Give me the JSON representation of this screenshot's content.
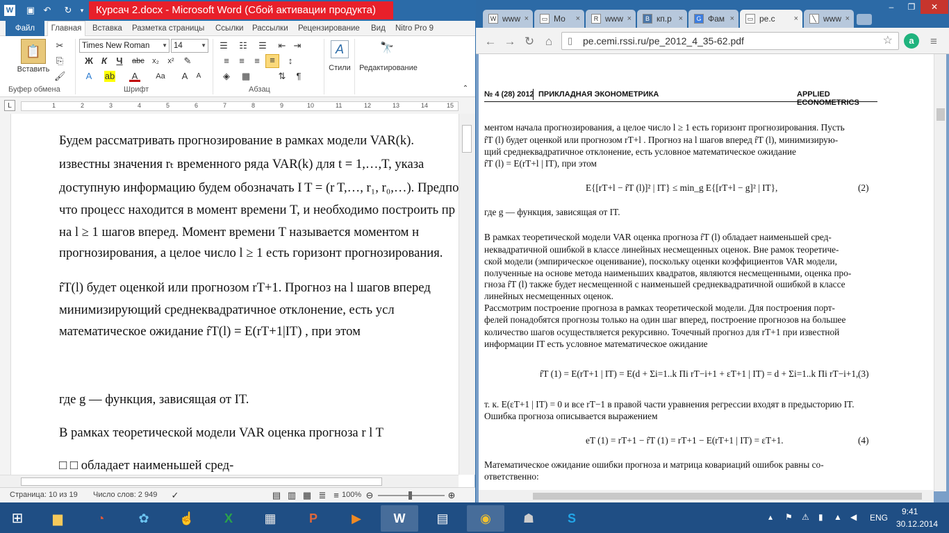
{
  "word": {
    "title": "Курсач 2.docx - Microsoft Word (Сбой активации продукта)",
    "tabs": [
      "Файл",
      "Главная",
      "Вставка",
      "Разметка страницы",
      "Ссылки",
      "Рассылки",
      "Рецензирование",
      "Вид",
      "Nitro Pro 9"
    ],
    "ribbon": {
      "paste_label": "Вставить",
      "font_name": "Times New Roman",
      "font_size": "14",
      "styles_label": "Стили",
      "editing_label": "Редактирование",
      "group_clipboard": "Буфер обмена",
      "group_font": "Шрифт",
      "group_paragraph": "Абзац"
    },
    "ruler_marks": [
      "1",
      "2",
      "3",
      "4",
      "5",
      "6",
      "7",
      "8",
      "9",
      "10",
      "11",
      "12",
      "13",
      "14",
      "15"
    ],
    "doc_lines": [
      "Будем  рассматривать  прогнозирование  в рамках  модели  VAR(k).",
      "известны значения rₜ временного ряда VAR(k) для t = 1,…,T, указа",
      "доступную информацию будем обозначать I T = (r T,…, r₁, r₀,…). Предпол",
      "что процесс находится в момент времени T, и необходимо построить пр",
      "на  l ≥ 1  шагов  вперед.  Момент  времени  T  называется  моментом  н",
      "прогнозирования, а целое число l ≥ 1 есть горизонт прогнозирования.",
      "r̂T(l)   будет  оценкой  или прогнозом  rT+1.  Прогноз  на  l шагов  вперед",
      "минимизирующий       среднеквадратичное       отклонение,       есть       усл",
      "математическое ожидание r̂T(l) = E(rT+1|IT) , при этом",
      "где g — функция, зависящая от IT.",
      "В рамках теоретической модели VAR оценка прогноза r l T",
      "  □  □  обладает наименьшей сред-"
    ],
    "status": {
      "page": "Страница: 10 из 19",
      "words": "Число слов: 2 949",
      "zoom": "100%"
    }
  },
  "chrome": {
    "tabs": [
      {
        "fav": "W",
        "label": "www"
      },
      {
        "fav": "▭",
        "label": "Мо"
      },
      {
        "fav": "R",
        "label": "www"
      },
      {
        "fav": "B",
        "label": "кп.р"
      },
      {
        "fav": "G",
        "label": "Фам"
      },
      {
        "fav": "▭",
        "label": "pe.c"
      },
      {
        "fav": "╲",
        "label": "www"
      }
    ],
    "url": "pe.cemi.rssi.ru/pe_2012_4_35-62.pdf",
    "pdf": {
      "header_left": "№ 4 (28) 2012",
      "header_mid": "ПРИКЛАДНАЯ ЭКОНОМЕТРИКА",
      "header_right": "APPLIED ECONOMETRICS",
      "lines": [
        "ментом начала прогнозирования, а целое число  l ≥ 1 есть горизонт прогнозирования. Пусть",
        "r̂T (l)  будет оценкой или прогнозом  rT+l . Прогноз на l шагов вперед  r̂T (l), минимизирую-",
        "щий  среднеквадратичное  отклонение,  есть  условное  математическое  ожидание",
        "r̂T (l) = E(rT+l | IT), при этом",
        "где g — функция, зависящая от IT.",
        "    В рамках теоретической модели VAR оценка прогноза r̂T (l) обладает наименьшей сред-",
        "неквадратичной ошибкой в классе линейных несмещенных оценок. Вне рамок теоретиче-",
        "ской модели (эмпирическое оценивание), поскольку оценки коэффициентов VAR модели,",
        "полученные на основе метода наименьших квадратов, являются несмещенными, оценка про-",
        "гноза r̂T (l) также будет несмещенной с наименьшей среднеквадратичной ошибкой в классе",
        "линейных несмещенных оценок.",
        "    Рассмотрим построение прогноза в рамках теоретической модели. Для построения порт-",
        "фелей понадобятся прогнозы только на один шаг вперед, построение прогнозов на большее",
        "количество шагов осуществляется рекурсивно. Точечный прогноз для rT+1 при известной",
        "информации IT есть условное математическое ожидание",
        "т. к.  E(εT+1 | IT) = 0  и все rT−1 в правой части уравнения регрессии входят в предысторию IT.",
        "Ошибка прогноза описывается выражением",
        "    Математическое ожидание ошибки прогноза и матрица ковариаций ошибок равны со-",
        "ответственно:"
      ],
      "eq2": "E{[rT+l − r̂T (l)]² | IT} ≤ min_g E{[rT+l − g]² | IT},",
      "eq2_num": "(2)",
      "eq3": "r̂T (1) = E(rT+1 | IT) = E(d + Σi=1..k Πi rT−i+1 + εT+1 | IT) = d + Σi=1..k Πi rT−i+1,",
      "eq3_num": "(3)",
      "eq4": "eT (1) = rT+1 − r̂T (1) = rT+1 − E(rT+1 | IT) = εT+1.",
      "eq4_num": "(4)"
    }
  },
  "taskbar": {
    "lang": "ENG",
    "time": "9:41",
    "date": "30.12.2014"
  }
}
